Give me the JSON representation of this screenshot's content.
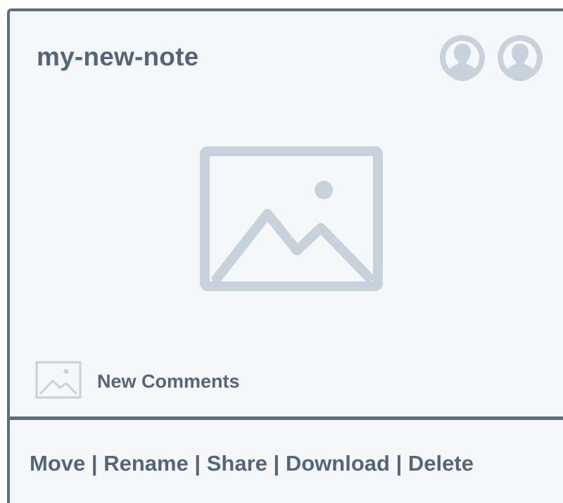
{
  "note": {
    "title": "my-new-note"
  },
  "collaborators": [
    {
      "icon": "user-avatar-icon"
    },
    {
      "icon": "user-avatar-icon"
    }
  ],
  "preview": {
    "icon": "image-placeholder-icon"
  },
  "comments": {
    "icon": "image-thumbnail-icon",
    "label": "New Comments"
  },
  "actions": {
    "move": "Move",
    "rename": "Rename",
    "share": "Share",
    "download": "Download",
    "delete": "Delete",
    "separator": "|"
  },
  "colors": {
    "text": "#56657a",
    "border": "#5e6e81",
    "background": "#f5f7f9",
    "placeholder": "#c8d2dc"
  }
}
